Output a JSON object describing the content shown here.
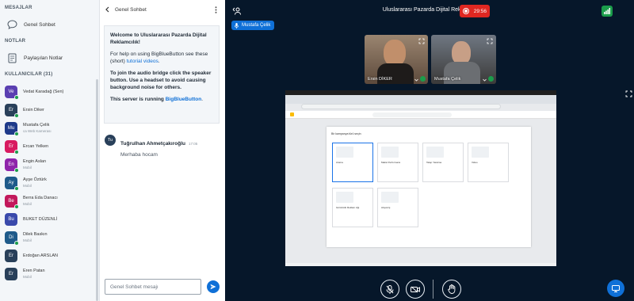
{
  "sidebar": {
    "messages_title": "MESAJLAR",
    "public_chat": "Genel Sohbet",
    "notes_title": "NOTLAR",
    "shared_notes": "Paylaşılan Notlar",
    "users_title": "KULLANICILAR (31)",
    "users": [
      {
        "initials": "Ve",
        "name": "Vedat Karadağ (Sen)",
        "sub": "",
        "color": "#5a3fb1",
        "dot": "#1b9d4b"
      },
      {
        "initials": "Er",
        "name": "Ersin Diker",
        "sub": "",
        "color": "#29405a",
        "dot": "#1b9d4b"
      },
      {
        "initials": "Mu",
        "name": "Mustafa Çelik",
        "sub": "ca Web Kamerası",
        "color": "#1e3a8a",
        "dot": "#1b9d4b"
      },
      {
        "initials": "Er",
        "name": "Ercan Yelken",
        "sub": "",
        "color": "#d81b60",
        "dot": "#1b9d4b"
      },
      {
        "initials": "En",
        "name": "Engin Aslan",
        "sub": "Mobil",
        "color": "#8e24aa",
        "dot": "#1b9d4b"
      },
      {
        "initials": "Ay",
        "name": "Ayşe Öztürk",
        "sub": "Mobil",
        "color": "#1e5a8a",
        "dot": "#1b9d4b"
      },
      {
        "initials": "Be",
        "name": "Berra Eda Danacı",
        "sub": "Mobil",
        "color": "#c2185b",
        "dot": "#1b9d4b"
      },
      {
        "initials": "Bu",
        "name": "BUKET DÜZENLİ",
        "sub": "",
        "color": "#3949ab",
        "dot": ""
      },
      {
        "initials": "Di",
        "name": "Dilek Baskın",
        "sub": "Mobil",
        "color": "#1e5a8a",
        "dot": "#1b9d4b"
      },
      {
        "initials": "Er",
        "name": "Erdoğan ARSLAN",
        "sub": "",
        "color": "#29405a",
        "dot": ""
      },
      {
        "initials": "Er",
        "name": "Eren Patan",
        "sub": "Mobil",
        "color": "#29405a",
        "dot": ""
      }
    ]
  },
  "chat": {
    "header": "Genel Sohbet",
    "welcome_title": "Welcome to Uluslararası Pazarda Dijital Reklamcılık!",
    "welcome_help_pre": "For help on using BigBlueButton see these (short) ",
    "welcome_help_link": "tutorial videos",
    "welcome_audio": "To join the audio bridge click the speaker button. Use a headset to avoid causing background noise for others.",
    "welcome_server_pre": "This server is running ",
    "welcome_server_link": "BigBlueButton",
    "message": {
      "initials": "Tu",
      "name": "Tuğrulhan Ahmetçakıroğlu",
      "time": "17:05",
      "text": "Merhaba hocam"
    },
    "input_placeholder": "Genel Sohbet mesajı"
  },
  "main": {
    "title": "Uluslararası Pazarda Dijital Reklamcılık",
    "record_time": "29:56",
    "presenter": "Mustafa Çelik",
    "videos": [
      {
        "name": "Ersin DİKER"
      },
      {
        "name": "Mustafa Çelik"
      }
    ],
    "screen": {
      "heading": "Bir kampanya türü seçin",
      "cards": [
        "Arama",
        "Maksi Performans",
        "Talep Yaratma",
        "Video",
        "Görüntülü Reklam Ağı",
        "Alışveriş"
      ]
    }
  },
  "colors": {
    "accent": "#0f70d7",
    "record": "#df2721",
    "online": "#1b9d4b",
    "background": "#06172a"
  }
}
